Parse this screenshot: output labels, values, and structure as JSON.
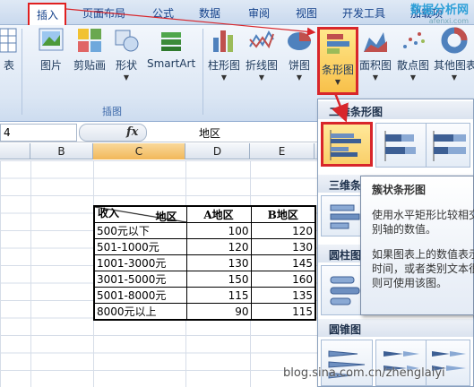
{
  "tabs": [
    "插入",
    "页面布局",
    "公式",
    "数据",
    "审阅",
    "视图",
    "开发工具",
    "加载项"
  ],
  "ribbon": {
    "left_cut_label": "表",
    "buttons": {
      "picture": "图片",
      "clipart": "剪贴画",
      "shapes": "形状",
      "smartart": "SmartArt",
      "column": "柱形图",
      "line": "折线图",
      "pie": "饼图",
      "bar": "条形图",
      "area": "面积图",
      "scatter": "散点图",
      "other": "其他图表"
    },
    "group_illustrations": "插图"
  },
  "formula_bar": {
    "namebox": "4",
    "fx": "fx",
    "value": "地区"
  },
  "columns": [
    "B",
    "C",
    "D",
    "E"
  ],
  "table": {
    "corner_top": "地区",
    "corner_bottom": "收入",
    "headers": [
      "A地区",
      "B地区"
    ],
    "rows": [
      {
        "label": "500元以下",
        "a": "100",
        "b": "120"
      },
      {
        "label": "501-1000元",
        "a": "120",
        "b": "130"
      },
      {
        "label": "1001-3000元",
        "a": "130",
        "b": "145"
      },
      {
        "label": "3001-5000元",
        "a": "150",
        "b": "160"
      },
      {
        "label": "5001-8000元",
        "a": "115",
        "b": "135"
      },
      {
        "label": "8000元以上",
        "a": "90",
        "b": "115"
      }
    ]
  },
  "dropdown": {
    "sections": [
      "二维条形图",
      "三维条",
      "圆柱图",
      "圆锥图"
    ]
  },
  "tooltip": {
    "title": "簇状条形图",
    "lines1": [
      "使用水平矩形比较相交",
      "别轴的数值。"
    ],
    "lines2": [
      "如果图表上的数值表示",
      "时间，或者类别文本很",
      "则可使用该图。"
    ]
  },
  "watermark": "blog.sina.com.cn/zhenglaiyi",
  "logo": {
    "main": "数据分析网",
    "sub": "afenxi.com"
  },
  "colors": {
    "highlight": "#d8262b",
    "accent": "#15428b"
  }
}
